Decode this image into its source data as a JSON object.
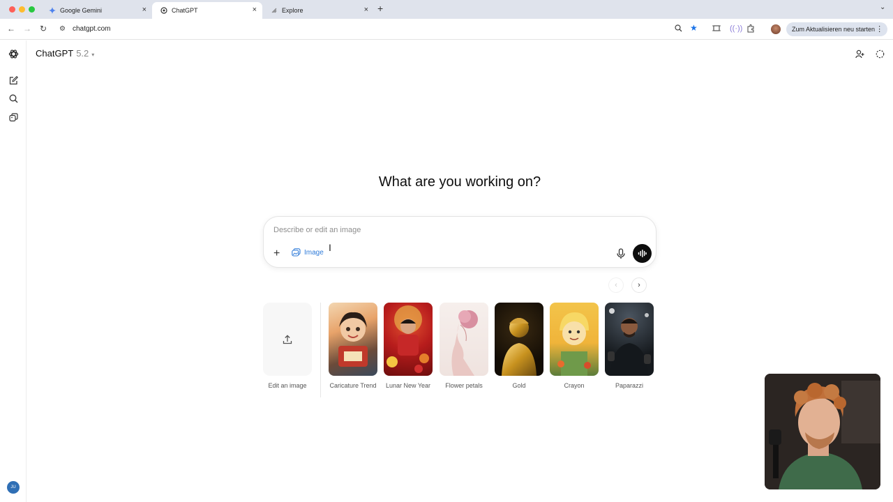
{
  "browser": {
    "tabs": [
      {
        "label": "Google Gemini",
        "active": false
      },
      {
        "label": "ChatGPT",
        "active": true
      },
      {
        "label": "Explore",
        "active": false
      }
    ],
    "url": "chatgpt.com",
    "update_button": "Zum Aktualisieren neu starten"
  },
  "header": {
    "model_name": "ChatGPT",
    "model_version": "5.2"
  },
  "main": {
    "heading": "What are you working on?",
    "composer": {
      "placeholder": "Describe or edit an image",
      "value": "",
      "image_chip_label": "Image"
    },
    "upload_card_label": "Edit an image",
    "styles": [
      {
        "label": "Caricature Trend"
      },
      {
        "label": "Lunar New Year"
      },
      {
        "label": "Flower petals"
      },
      {
        "label": "Gold"
      },
      {
        "label": "Crayon"
      },
      {
        "label": "Paparazzi"
      }
    ]
  },
  "user": {
    "initials": "JU"
  },
  "colors": {
    "accent": "#2f7bd9",
    "send": "#0d0d0d"
  },
  "icons": [
    "chatgpt-logo-icon",
    "new-chat-icon",
    "search-icon",
    "library-icon",
    "add-person-icon",
    "temporary-chat-icon",
    "plus-icon",
    "image-icon",
    "microphone-icon",
    "voice-mode-icon",
    "upload-icon",
    "chevron-left-icon",
    "chevron-right-icon"
  ]
}
